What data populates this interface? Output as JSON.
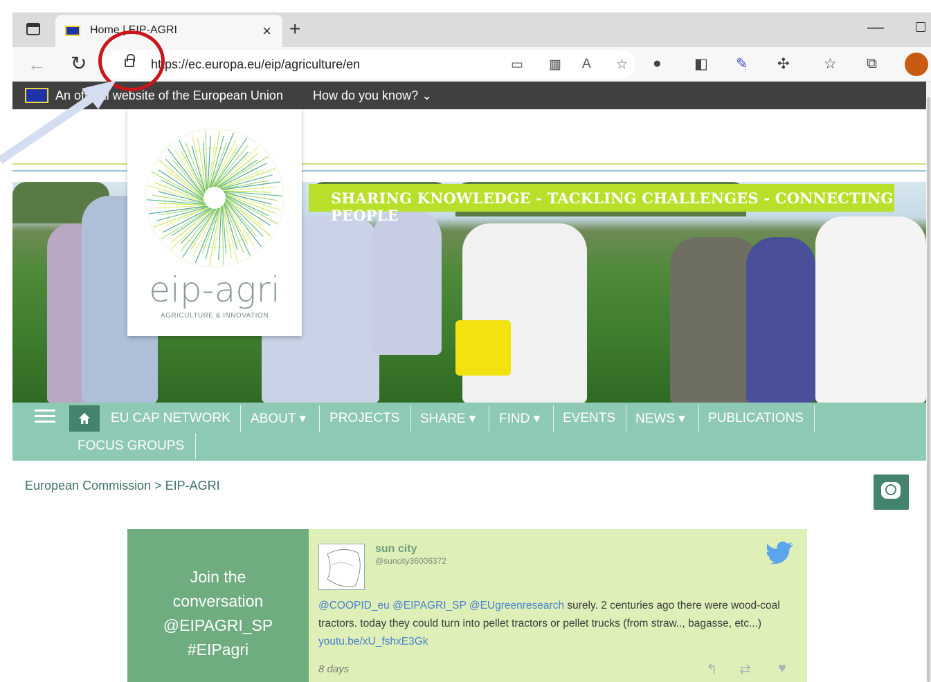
{
  "browser": {
    "tab_title": "Home | EIP-AGRI",
    "tab_close": "×",
    "new_tab": "+",
    "minimize": "—",
    "url": "https://ec.europa.eu/eip/agriculture/en",
    "back_glyph": "←",
    "reload_glyph": "↻",
    "profile_color": "#c85a12"
  },
  "eu_bar": {
    "text": "An official website of the European Union",
    "how_link": "How do you know? ⌄"
  },
  "hero": {
    "tagline": "SHARING KNOWLEDGE - TACKLING CHALLENGES - CONNECTING PEOPLE",
    "logo_name": "eip-agri",
    "logo_sub": "AGRICULTURE & INNOVATION",
    "accent": "#b8e02a"
  },
  "nav": {
    "items": [
      "EU CAP NETWORK",
      "ABOUT ▾",
      "PROJECTS",
      "SHARE ▾",
      "FIND ▾",
      "EVENTS",
      "NEWS ▾",
      "PUBLICATIONS",
      "FOCUS GROUPS"
    ],
    "color": "#8ec9b4",
    "home_color": "#44836e"
  },
  "breadcrumb": {
    "text": "European Commission > EIP-AGRI"
  },
  "twitter": {
    "join": {
      "line1": "Join the",
      "line2": "conversation",
      "line3": "@EIPAGRI_SP",
      "line4": "#EIPagri"
    },
    "tweet": {
      "name": "sun city",
      "handle": "@suncity36006372",
      "mention1": "@COOPID_eu",
      "mention2": "@EIPAGRI_SP",
      "mention3": "@EUgreenresearch",
      "text_a": "surely. 2 centuries ago there were wood-coal tractors. today they could turn into pellet tractors or pellet trucks (from straw.., bagasse, etc...)",
      "link": "youtu.be/xU_fshxE3Gk",
      "time": "8 days",
      "reply": "↰",
      "retweet": "⇄",
      "like": "♥"
    }
  }
}
